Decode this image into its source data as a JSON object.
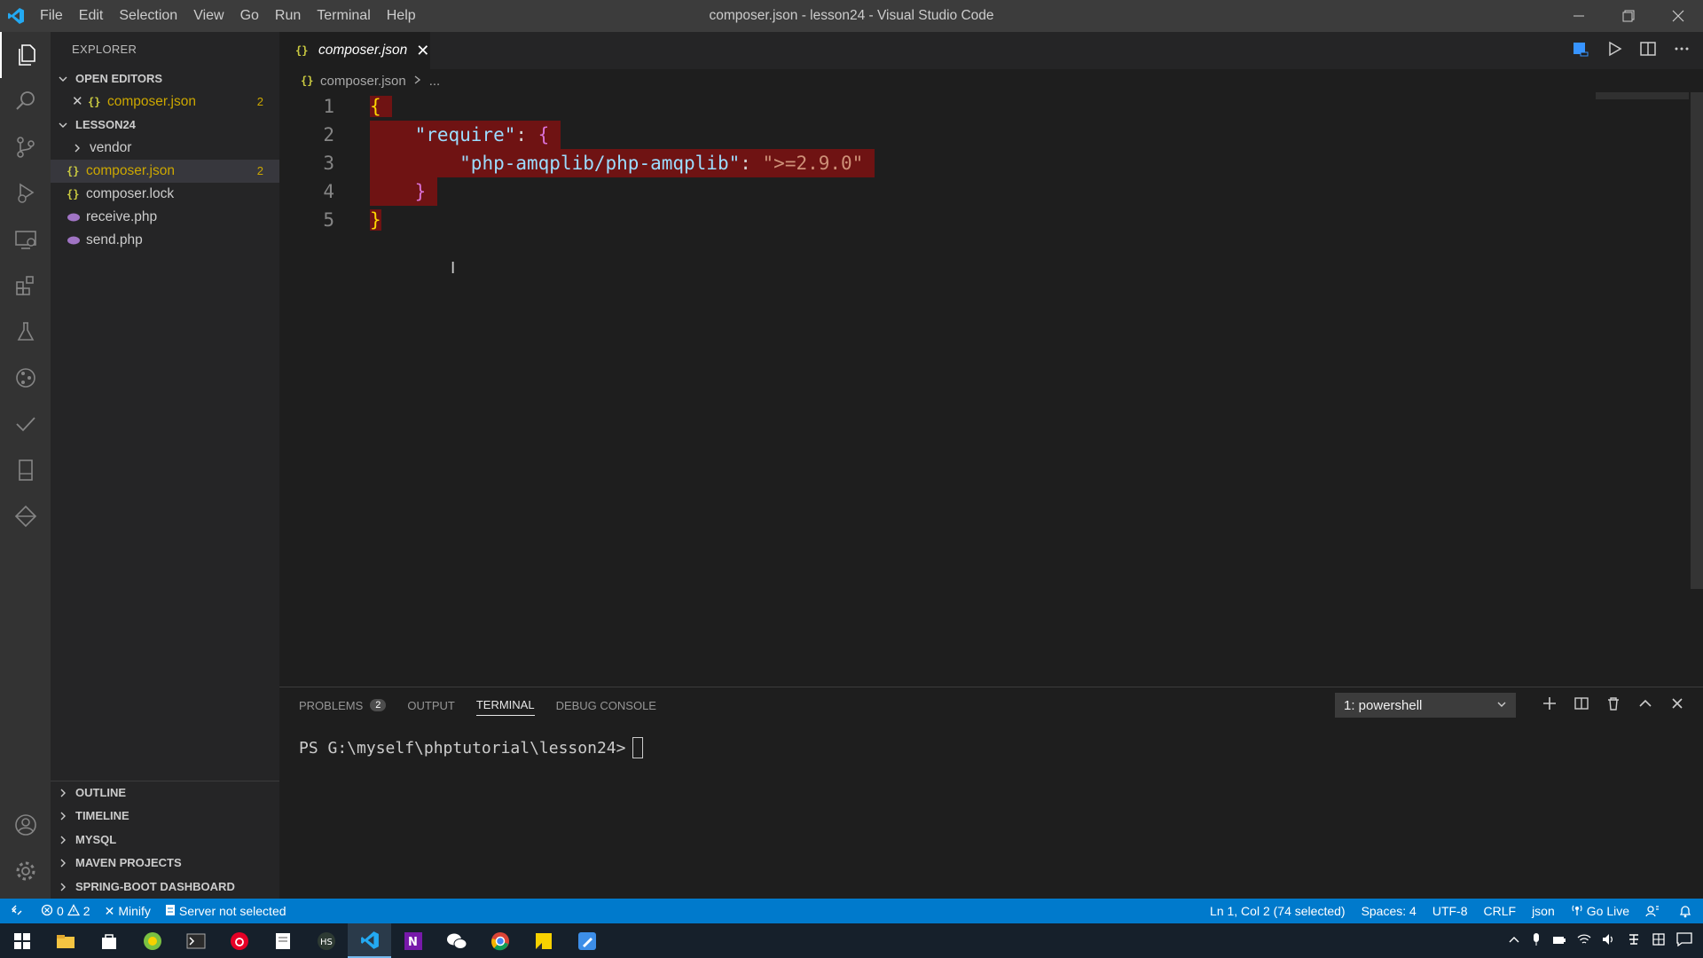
{
  "window": {
    "title": "composer.json - lesson24 - Visual Studio Code",
    "menu": [
      "File",
      "Edit",
      "Selection",
      "View",
      "Go",
      "Run",
      "Terminal",
      "Help"
    ]
  },
  "sidebar": {
    "title": "EXPLORER",
    "open_editors": {
      "label": "OPEN EDITORS",
      "items": [
        {
          "name": "composer.json",
          "badge": "2"
        }
      ]
    },
    "folder": {
      "label": "LESSON24",
      "items": [
        {
          "name": "vendor",
          "type": "folder"
        },
        {
          "name": "composer.json",
          "type": "json",
          "badge": "2"
        },
        {
          "name": "composer.lock",
          "type": "json"
        },
        {
          "name": "receive.php",
          "type": "php"
        },
        {
          "name": "send.php",
          "type": "php"
        }
      ]
    },
    "bottom_sections": [
      "OUTLINE",
      "TIMELINE",
      "MYSQL",
      "MAVEN PROJECTS",
      "SPRING-BOOT DASHBOARD"
    ]
  },
  "editor": {
    "tab_label": "composer.json",
    "breadcrumb": {
      "file": "composer.json",
      "more": "..."
    },
    "line_numbers": [
      "1",
      "2",
      "3",
      "4",
      "5"
    ],
    "code": {
      "l1_open": "{",
      "l2_key": "\"require\"",
      "l2_colon": ": ",
      "l2_open": "{",
      "l3_key": "\"php-amqplib/php-amqplib\"",
      "l3_colon": ": ",
      "l3_value": "\">=2.9.0\"",
      "l4_close": "}",
      "l5_close": "}"
    }
  },
  "panel": {
    "tabs": [
      {
        "label": "PROBLEMS",
        "count": "2"
      },
      {
        "label": "OUTPUT"
      },
      {
        "label": "TERMINAL",
        "active": true
      },
      {
        "label": "DEBUG CONSOLE"
      }
    ],
    "terminal_select": "1: powershell",
    "prompt": "PS G:\\myself\\phptutorial\\lesson24>"
  },
  "statusbar": {
    "errors": "0",
    "warnings": "2",
    "minify": "Minify",
    "server": "Server not selected",
    "position": "Ln 1, Col 2 (74 selected)",
    "spaces": "Spaces: 4",
    "encoding": "UTF-8",
    "eol": "CRLF",
    "language": "json",
    "golive": "Go Live"
  },
  "colors": {
    "accent": "#007acc",
    "selection": "#6f1313",
    "json_key": "#9cdcfe",
    "json_string": "#ce9178"
  }
}
